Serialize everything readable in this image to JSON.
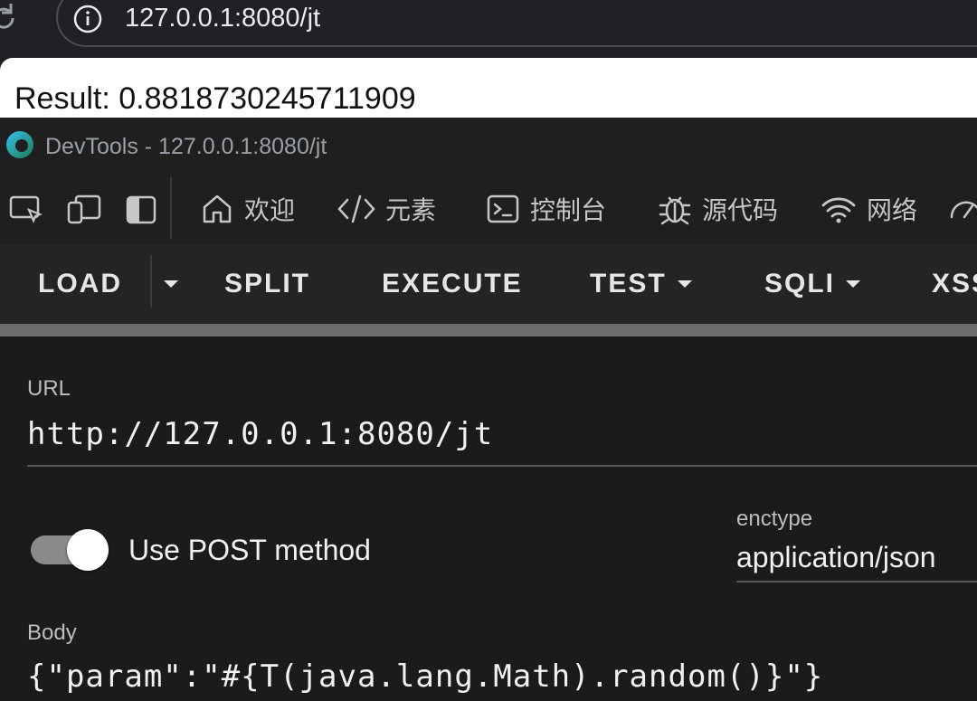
{
  "browser": {
    "url": "127.0.0.1:8080/jt"
  },
  "page": {
    "result_text": "Result: 0.8818730245711909"
  },
  "devtools": {
    "title": "DevTools - 127.0.0.1:8080/jt",
    "tabs": [
      {
        "label": "欢迎",
        "icon": "home-icon"
      },
      {
        "label": "元素",
        "icon": "code-icon"
      },
      {
        "label": "控制台",
        "icon": "console-icon"
      },
      {
        "label": "源代码",
        "icon": "bug-icon"
      },
      {
        "label": "网络",
        "icon": "wifi-icon"
      }
    ]
  },
  "hackbar": {
    "toolbar": {
      "load": "LOAD",
      "split": "SPLIT",
      "execute": "EXECUTE",
      "test": "TEST",
      "sqli": "SQLI",
      "xss": "XSS"
    },
    "url_label": "URL",
    "url_value": "http://127.0.0.1:8080/jt",
    "post_toggle_label": "Use POST method",
    "post_enabled": true,
    "enctype_label": "enctype",
    "enctype_value": "application/json",
    "body_label": "Body",
    "body_value": "{\"param\":\"#{T(java.lang.Math).random()}\"}"
  },
  "colors": {
    "devtools_bg": "#1f1f1f",
    "panel_bg": "#1b1b1b",
    "page_bg": "#ffffff"
  }
}
